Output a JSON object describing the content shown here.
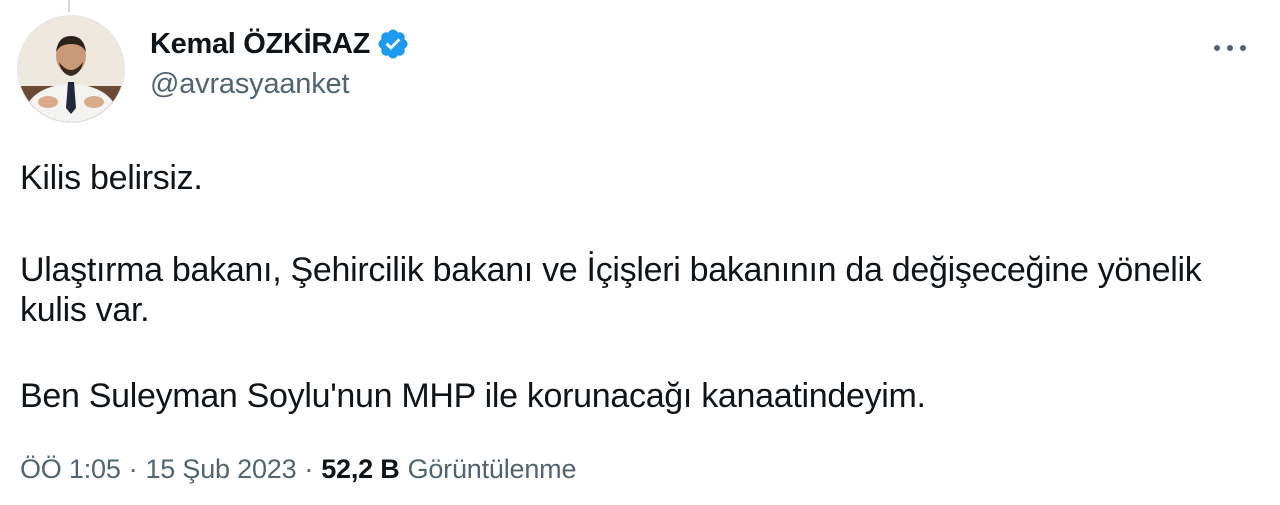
{
  "author": {
    "display_name": "Kemal ÖZKİRAZ",
    "handle": "@avrasyaanket",
    "verified_icon": "verified-badge-icon",
    "verified_color": "#1d9bf0"
  },
  "tweet": {
    "paragraph_1": "Kilis belirsiz.",
    "paragraph_2": "Ulaştırma bakanı, Şehircilik bakanı ve İçişleri bakanının da değişeceğine yönelik kulis var.",
    "paragraph_3": "Ben Suleyman Soylu'nun MHP ile korunacağı kanaatindeyim."
  },
  "meta": {
    "time": "ÖÖ 1:05",
    "separator": "·",
    "date": "15 Şub 2023",
    "views_count": "52,2 B",
    "views_label": "Görüntülenme"
  },
  "more_icon": "more-options-icon",
  "colors": {
    "text": "#0f1419",
    "secondary": "#536471"
  }
}
